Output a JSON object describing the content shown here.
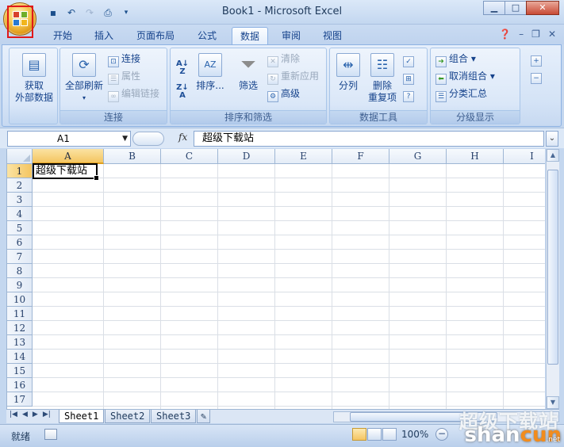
{
  "window": {
    "title": "Book1 - Microsoft Excel"
  },
  "tabs": [
    "开始",
    "插入",
    "页面布局",
    "公式",
    "数据",
    "审阅",
    "视图"
  ],
  "active_tab": "数据",
  "ribbon": {
    "get_external": {
      "label1": "获取",
      "label2": "外部数据"
    },
    "connections": {
      "refresh_all": "全部刷新",
      "connect": "连接",
      "properties": "属性",
      "edit_links": "编辑链接",
      "group_label": "连接"
    },
    "sort_filter": {
      "sort": "排序...",
      "filter": "筛选",
      "clear": "清除",
      "reapply": "重新应用",
      "advanced": "高级",
      "group_label": "排序和筛选"
    },
    "data_tools": {
      "text_to_columns": "分列",
      "remove_dup1": "删除",
      "remove_dup2": "重复项",
      "group_label": "数据工具"
    },
    "outline": {
      "group": "组合",
      "ungroup": "取消组合",
      "subtotal": "分类汇总",
      "group_label": "分级显示"
    }
  },
  "formula_bar": {
    "name_box": "A1",
    "fx": "fx",
    "content": "超级下载站"
  },
  "grid": {
    "columns": [
      "A",
      "B",
      "C",
      "D",
      "E",
      "F",
      "G",
      "H",
      "I"
    ],
    "rows": [
      "1",
      "2",
      "3",
      "4",
      "5",
      "6",
      "7",
      "8",
      "9",
      "10",
      "11",
      "12",
      "13",
      "14",
      "15",
      "16",
      "17"
    ],
    "cell_A1": "超级下载站",
    "selected_cell": "A1"
  },
  "sheets": [
    "Sheet1",
    "Sheet2",
    "Sheet3"
  ],
  "active_sheet": "Sheet1",
  "status": {
    "ready": "就绪",
    "zoom": "100%"
  },
  "watermark": {
    "line1": "超级下载站",
    "line2_a": "shan",
    "line2_b": "cun",
    "line2_c": ".net"
  },
  "colors": {
    "accent": "#15428b",
    "ribbon_bg": "#dbe7f8",
    "office_button_highlight": "#e0181b"
  }
}
